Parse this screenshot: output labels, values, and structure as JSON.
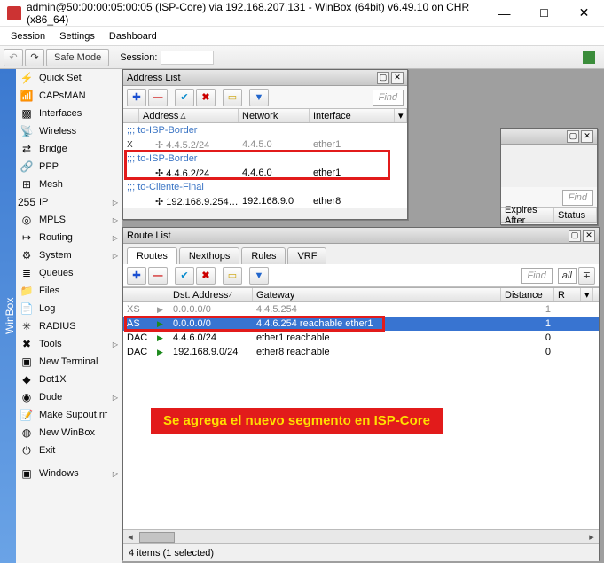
{
  "titlebar": {
    "title": "admin@50:00:00:05:00:05 (ISP-Core) via 192.168.207.131 - WinBox (64bit) v6.49.10 on CHR (x86_64)"
  },
  "menu": {
    "session": "Session",
    "settings": "Settings",
    "dashboard": "Dashboard"
  },
  "toolbar": {
    "undo": "↶",
    "redo": "↷",
    "safe_mode": "Safe Mode",
    "session_lbl": "Session:"
  },
  "sidebar": {
    "items": [
      {
        "icon": "⚡",
        "label": "Quick Set",
        "sub": false
      },
      {
        "icon": "📶",
        "label": "CAPsMAN",
        "sub": false
      },
      {
        "icon": "▩",
        "label": "Interfaces",
        "sub": false
      },
      {
        "icon": "📡",
        "label": "Wireless",
        "sub": false
      },
      {
        "icon": "⇄",
        "label": "Bridge",
        "sub": false
      },
      {
        "icon": "🔗",
        "label": "PPP",
        "sub": false
      },
      {
        "icon": "⊞",
        "label": "Mesh",
        "sub": false
      },
      {
        "icon": "255",
        "label": "IP",
        "sub": true
      },
      {
        "icon": "◎",
        "label": "MPLS",
        "sub": true
      },
      {
        "icon": "↦",
        "label": "Routing",
        "sub": true
      },
      {
        "icon": "⚙",
        "label": "System",
        "sub": true
      },
      {
        "icon": "≣",
        "label": "Queues",
        "sub": false
      },
      {
        "icon": "📁",
        "label": "Files",
        "sub": false
      },
      {
        "icon": "📄",
        "label": "Log",
        "sub": false
      },
      {
        "icon": "✳",
        "label": "RADIUS",
        "sub": false
      },
      {
        "icon": "✖",
        "label": "Tools",
        "sub": true
      },
      {
        "icon": "▣",
        "label": "New Terminal",
        "sub": false
      },
      {
        "icon": "◆",
        "label": "Dot1X",
        "sub": false
      },
      {
        "icon": "◉",
        "label": "Dude",
        "sub": true
      },
      {
        "icon": "📝",
        "label": "Make Supout.rif",
        "sub": false
      },
      {
        "icon": "◍",
        "label": "New WinBox",
        "sub": false
      },
      {
        "icon": "⏻",
        "label": "Exit",
        "sub": false
      }
    ],
    "windows": "Windows"
  },
  "rail": "WinBox",
  "addr_win": {
    "title": "Address List",
    "find": "Find",
    "head": {
      "address": "Address",
      "network": "Network",
      "interface": "Interface"
    },
    "rows": [
      {
        "comment": ";;; to-ISP-Border"
      },
      {
        "flag": "X",
        "addr": "✢ 4.4.5.2/24",
        "net": "4.4.5.0",
        "iface": "ether1",
        "dim": true
      },
      {
        "comment": ";;; to-ISP-Border"
      },
      {
        "flag": "",
        "addr": "✢ 4.4.6.2/24",
        "net": "4.4.6.0",
        "iface": "ether1"
      },
      {
        "comment": ";;; to-Cliente-Final"
      },
      {
        "flag": "",
        "addr": "✢ 192.168.9.254…",
        "net": "192.168.9.0",
        "iface": "ether8"
      }
    ]
  },
  "stub_win": {
    "find": "Find",
    "head": {
      "expires": "Expires After",
      "status": "Status"
    }
  },
  "route_win": {
    "title": "Route List",
    "tabs": {
      "routes": "Routes",
      "nexthops": "Nexthops",
      "rules": "Rules",
      "vrf": "VRF"
    },
    "find": "Find",
    "all": "all",
    "head": {
      "dst": "Dst. Address",
      "gw": "Gateway",
      "dist": "Distance",
      "r": "R"
    },
    "rows": [
      {
        "flag": "XS",
        "tri": "gray",
        "dst": "0.0.0.0/0",
        "gw": "4.4.5.254",
        "dist": "1",
        "sel": false,
        "dim": true
      },
      {
        "flag": "AS",
        "tri": "green",
        "dst": "0.0.0.0/0",
        "gw": "4.4.6.254 reachable ether1",
        "dist": "1",
        "sel": true
      },
      {
        "flag": "DAC",
        "tri": "green",
        "dst": "4.4.6.0/24",
        "gw": "ether1 reachable",
        "dist": "0",
        "sel": false
      },
      {
        "flag": "DAC",
        "tri": "green",
        "dst": "192.168.9.0/24",
        "gw": "ether8 reachable",
        "dist": "0",
        "sel": false
      }
    ],
    "status": "4 items (1 selected)"
  },
  "banner": "Se agrega el nuevo segmento en ISP-Core"
}
